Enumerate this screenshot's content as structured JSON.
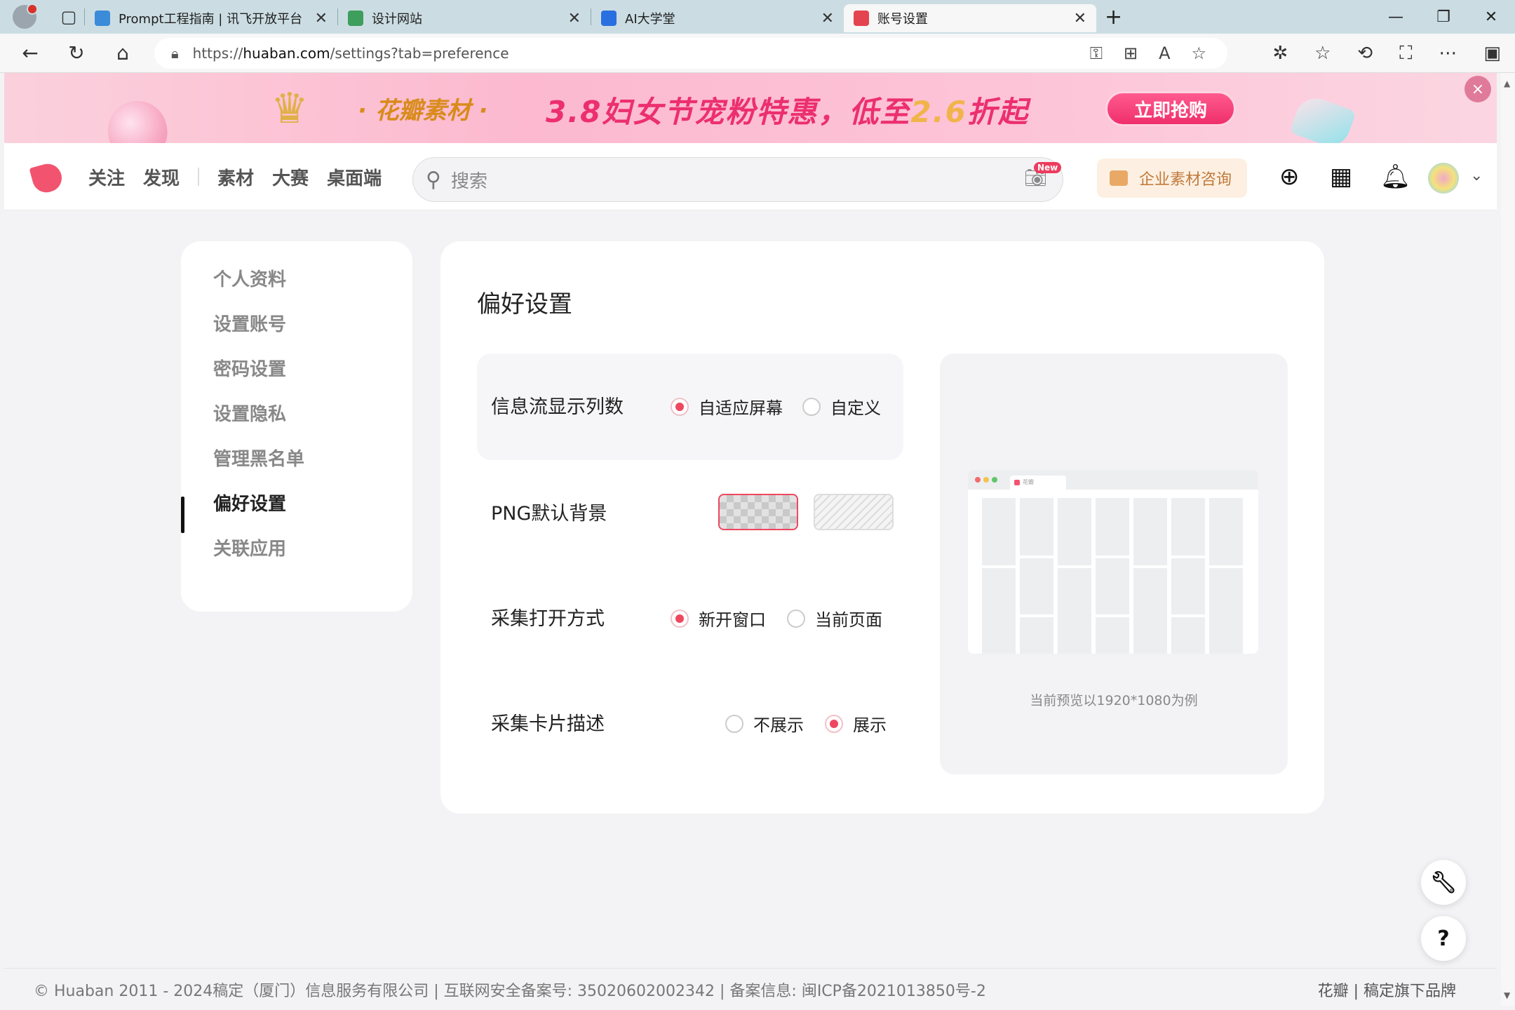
{
  "browser": {
    "tabs": [
      {
        "title": "Prompt工程指南 | 讯飞开放平台",
        "favicon_color": "#3b8bd9"
      },
      {
        "title": "设计网站",
        "favicon_color": "#3e9e5c"
      },
      {
        "title": "AI大学堂",
        "favicon_color": "#2a6fe0"
      },
      {
        "title": "账号设置",
        "favicon_color": "#e4444f",
        "active": true
      }
    ],
    "url": {
      "scheme": "https://",
      "host": "huaban.com",
      "path": "/settings?tab=preference"
    }
  },
  "banner": {
    "brand": "· 花瓣素材 ·",
    "promo_prefix": "3.8妇女节宠粉特惠，低至",
    "promo_num": "2.6",
    "promo_suffix": "折起",
    "cta": "立即抢购",
    "close": "×"
  },
  "header": {
    "nav_left": [
      "关注",
      "发现"
    ],
    "nav_right": [
      "素材",
      "大赛",
      "桌面端"
    ],
    "search_placeholder": "搜索",
    "new_badge": "New",
    "consult": "企业素材咨询"
  },
  "sidebar": {
    "items": [
      {
        "label": "个人资料"
      },
      {
        "label": "设置账号"
      },
      {
        "label": "密码设置"
      },
      {
        "label": "设置隐私"
      },
      {
        "label": "管理黑名单"
      },
      {
        "label": "偏好设置",
        "active": true
      },
      {
        "label": "关联应用"
      }
    ]
  },
  "settings": {
    "title": "偏好设置",
    "feed_columns": {
      "label": "信息流显示列数",
      "options": [
        "自适应屏幕",
        "自定义"
      ],
      "selected": "自适应屏幕"
    },
    "png_bg": {
      "label": "PNG默认背景",
      "options": [
        "checkerboard",
        "stripes"
      ],
      "selected": "checkerboard"
    },
    "collect_open": {
      "label": "采集打开方式",
      "options": [
        "新开窗口",
        "当前页面"
      ],
      "selected": "新开窗口"
    },
    "collect_desc": {
      "label": "采集卡片描述",
      "options": [
        "不展示",
        "展示"
      ],
      "selected": "展示"
    },
    "preview_caption": "当前预览以1920*1080为例",
    "preview_tab": "花瓣"
  },
  "footer": {
    "left": "© Huaban 2011 - 2024稿定（厦门）信息服务有限公司 | 互联网安全备案号: 35020602002342 | 备案信息: 闽ICP备2021013850号-2",
    "right": "花瓣 | 稿定旗下品牌"
  },
  "colors": {
    "accent": "#ef4760",
    "brand": "#f2546f"
  }
}
